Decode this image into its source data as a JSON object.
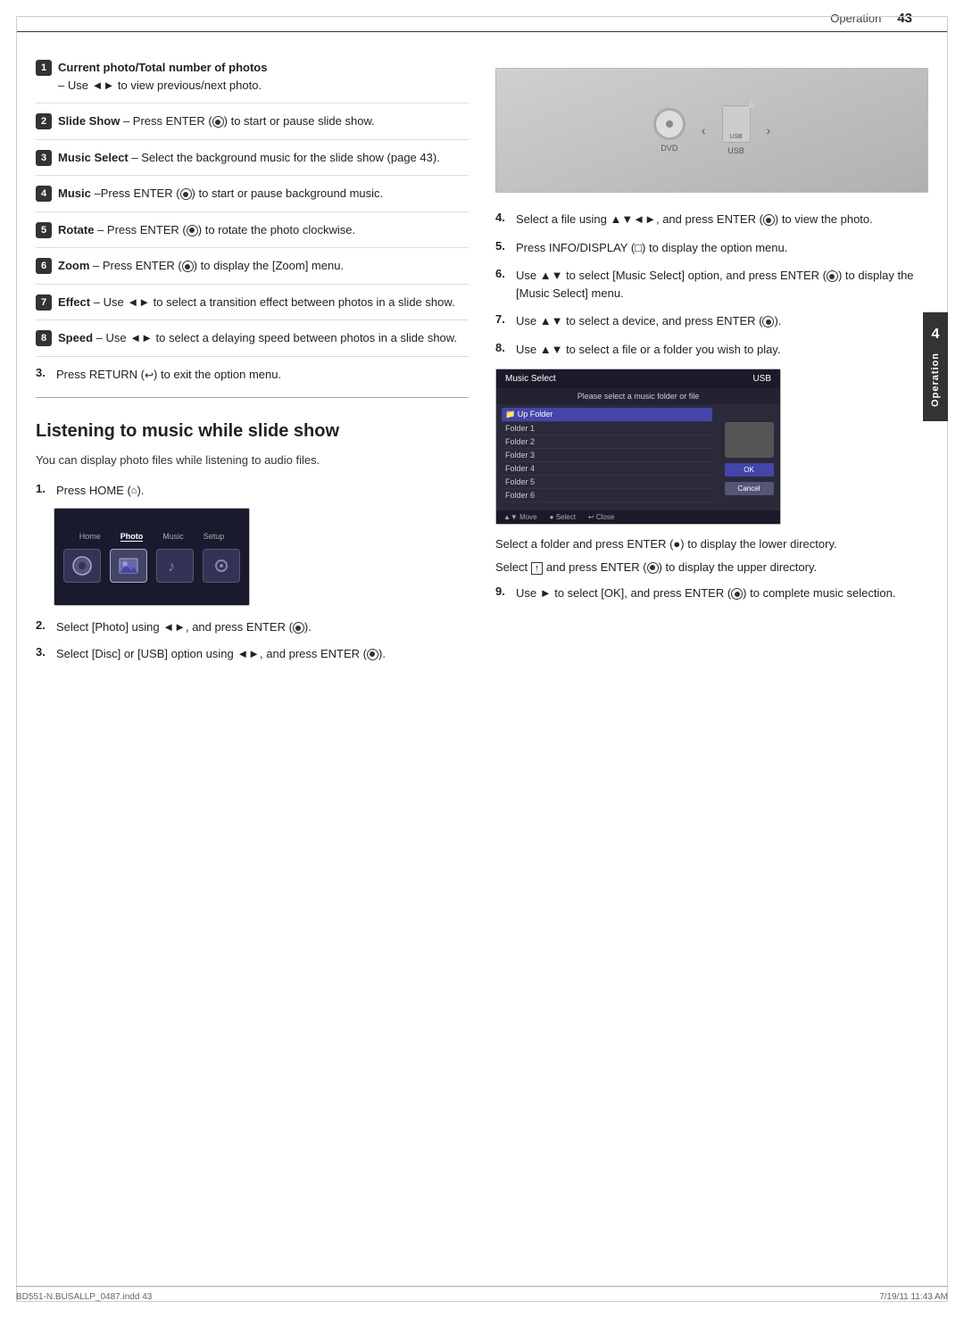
{
  "page": {
    "title": "Operation",
    "page_number": "43",
    "footer_left": "BD551-N.BUSALLP_0487.indd   43",
    "footer_right": "7/19/11   11:43 AM"
  },
  "left_col": {
    "numbered_items": [
      {
        "num": "1",
        "bold": "Current photo/Total number of photos",
        "text": "– Use ◄► to view previous/next photo."
      },
      {
        "num": "2",
        "bold": "Slide Show",
        "text": "– Press ENTER (●) to start or pause slide show."
      },
      {
        "num": "3",
        "bold": "Music Select",
        "text": "– Select the background music for the slide show (page 43)."
      },
      {
        "num": "4",
        "bold": "Music",
        "text": "–Press ENTER (●) to start or pause background music."
      },
      {
        "num": "5",
        "bold": "Rotate",
        "text": "– Press ENTER (●) to rotate the photo clockwise."
      },
      {
        "num": "6",
        "bold": "Zoom",
        "text": "– Press ENTER (●) to display the [Zoom] menu."
      },
      {
        "num": "7",
        "bold": "Effect",
        "text": "– Use ◄► to select a transition effect between photos in a slide show."
      },
      {
        "num": "8",
        "bold": "Speed",
        "text": "– Use ◄► to select a delaying speed between photos in a slide show."
      }
    ],
    "step3_text": "Press RETURN (↩) to exit the option menu.",
    "section_title": "Listening to music while slide show",
    "section_desc": "You can display photo files while listening to audio files.",
    "steps": [
      {
        "num": "1.",
        "text": "Press HOME (⌂)."
      },
      {
        "num": "2.",
        "text": "Select [Photo] using ◄►, and press ENTER (●)."
      },
      {
        "num": "3.",
        "text": "Select [Disc] or [USB] option using ◄►, and press ENTER (●)."
      }
    ]
  },
  "right_col": {
    "steps": [
      {
        "num": "4.",
        "text": "Select a file using ▲▼◄►, and press ENTER (●) to view the photo."
      },
      {
        "num": "5.",
        "text": "Press INFO/DISPLAY (□) to display the option menu."
      },
      {
        "num": "6.",
        "text": "Use ▲▼ to select [Music Select] option, and press ENTER (●) to display the [Music Select] menu."
      },
      {
        "num": "7.",
        "text": "Use ▲▼ to select a device, and press ENTER (●)."
      },
      {
        "num": "8.",
        "text": "Use ▲▼ to select a file or a folder you wish to play."
      }
    ],
    "music_select_title": "Music Select",
    "music_select_subtitle": "Please select a music folder or file",
    "music_select_source": "USB",
    "folder_label": "Up Folder",
    "folder_items": [
      "Folder 1",
      "Folder 2",
      "Folder 3",
      "Folder 4",
      "Folder 5",
      "Folder 6"
    ],
    "btn_ok": "OK",
    "btn_cancel": "Cancel",
    "footer_move": "Move",
    "footer_select": "Select",
    "footer_close": "Close",
    "step9_text_a": "Select a folder and press ENTER (●) to display the lower directory.",
    "step9_text_b": "Select ↑ and press ENTER (●) to display the upper directory.",
    "step9": {
      "num": "9.",
      "text": "Use ► to select [OK], and press ENTER (●) to complete music selection."
    }
  },
  "side_tab": {
    "num": "4",
    "label": "Operation"
  }
}
